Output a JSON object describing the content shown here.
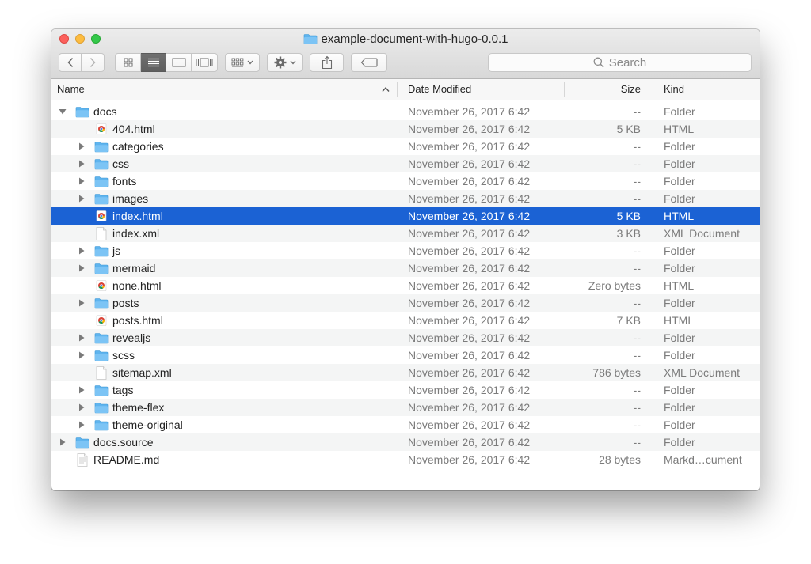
{
  "window": {
    "title": "example-document-with-hugo-0.0.1"
  },
  "toolbar": {
    "search_placeholder": "Search",
    "icons": [
      "chevron-left-icon",
      "chevron-right-icon",
      "icon-view-icon",
      "list-view-icon",
      "column-view-icon",
      "cover-flow-icon",
      "arrange-icon",
      "gear-icon",
      "share-icon",
      "tag-icon",
      "search-icon"
    ],
    "active_view": "list"
  },
  "columns": {
    "name": "Name",
    "date": "Date Modified",
    "size": "Size",
    "kind": "Kind"
  },
  "colors": {
    "selection": "#1b62d4",
    "folder": "#5fb4ee",
    "close": "#fc605c",
    "minimize": "#fdbc40",
    "zoom": "#34c84a"
  },
  "files": [
    {
      "name": "docs",
      "date": "November 26, 2017 6:42",
      "size": "--",
      "kind": "Folder",
      "icon": "folder",
      "level": 0,
      "disclosure": "down",
      "selected": false
    },
    {
      "name": "404.html",
      "date": "November 26, 2017 6:42",
      "size": "5 KB",
      "kind": "HTML",
      "icon": "chrome",
      "level": 1,
      "disclosure": "none",
      "selected": false
    },
    {
      "name": "categories",
      "date": "November 26, 2017 6:42",
      "size": "--",
      "kind": "Folder",
      "icon": "folder",
      "level": 1,
      "disclosure": "right",
      "selected": false
    },
    {
      "name": "css",
      "date": "November 26, 2017 6:42",
      "size": "--",
      "kind": "Folder",
      "icon": "folder",
      "level": 1,
      "disclosure": "right",
      "selected": false
    },
    {
      "name": "fonts",
      "date": "November 26, 2017 6:42",
      "size": "--",
      "kind": "Folder",
      "icon": "folder",
      "level": 1,
      "disclosure": "right",
      "selected": false
    },
    {
      "name": "images",
      "date": "November 26, 2017 6:42",
      "size": "--",
      "kind": "Folder",
      "icon": "folder",
      "level": 1,
      "disclosure": "right",
      "selected": false
    },
    {
      "name": "index.html",
      "date": "November 26, 2017 6:42",
      "size": "5 KB",
      "kind": "HTML",
      "icon": "chrome",
      "level": 1,
      "disclosure": "none",
      "selected": true
    },
    {
      "name": "index.xml",
      "date": "November 26, 2017 6:42",
      "size": "3 KB",
      "kind": "XML Document",
      "icon": "doc",
      "level": 1,
      "disclosure": "none",
      "selected": false
    },
    {
      "name": "js",
      "date": "November 26, 2017 6:42",
      "size": "--",
      "kind": "Folder",
      "icon": "folder",
      "level": 1,
      "disclosure": "right",
      "selected": false
    },
    {
      "name": "mermaid",
      "date": "November 26, 2017 6:42",
      "size": "--",
      "kind": "Folder",
      "icon": "folder",
      "level": 1,
      "disclosure": "right",
      "selected": false
    },
    {
      "name": "none.html",
      "date": "November 26, 2017 6:42",
      "size": "Zero bytes",
      "kind": "HTML",
      "icon": "chrome",
      "level": 1,
      "disclosure": "none",
      "selected": false
    },
    {
      "name": "posts",
      "date": "November 26, 2017 6:42",
      "size": "--",
      "kind": "Folder",
      "icon": "folder",
      "level": 1,
      "disclosure": "right",
      "selected": false
    },
    {
      "name": "posts.html",
      "date": "November 26, 2017 6:42",
      "size": "7 KB",
      "kind": "HTML",
      "icon": "chrome",
      "level": 1,
      "disclosure": "none",
      "selected": false
    },
    {
      "name": "revealjs",
      "date": "November 26, 2017 6:42",
      "size": "--",
      "kind": "Folder",
      "icon": "folder",
      "level": 1,
      "disclosure": "right",
      "selected": false
    },
    {
      "name": "scss",
      "date": "November 26, 2017 6:42",
      "size": "--",
      "kind": "Folder",
      "icon": "folder",
      "level": 1,
      "disclosure": "right",
      "selected": false
    },
    {
      "name": "sitemap.xml",
      "date": "November 26, 2017 6:42",
      "size": "786 bytes",
      "kind": "XML Document",
      "icon": "doc",
      "level": 1,
      "disclosure": "none",
      "selected": false
    },
    {
      "name": "tags",
      "date": "November 26, 2017 6:42",
      "size": "--",
      "kind": "Folder",
      "icon": "folder",
      "level": 1,
      "disclosure": "right",
      "selected": false
    },
    {
      "name": "theme-flex",
      "date": "November 26, 2017 6:42",
      "size": "--",
      "kind": "Folder",
      "icon": "folder",
      "level": 1,
      "disclosure": "right",
      "selected": false
    },
    {
      "name": "theme-original",
      "date": "November 26, 2017 6:42",
      "size": "--",
      "kind": "Folder",
      "icon": "folder",
      "level": 1,
      "disclosure": "right",
      "selected": false
    },
    {
      "name": "docs.source",
      "date": "November 26, 2017 6:42",
      "size": "--",
      "kind": "Folder",
      "icon": "folder",
      "level": 0,
      "disclosure": "right",
      "selected": false
    },
    {
      "name": "README.md",
      "date": "November 26, 2017 6:42",
      "size": "28 bytes",
      "kind": "Markd…cument",
      "icon": "textdoc",
      "level": 0,
      "disclosure": "none",
      "selected": false
    }
  ]
}
